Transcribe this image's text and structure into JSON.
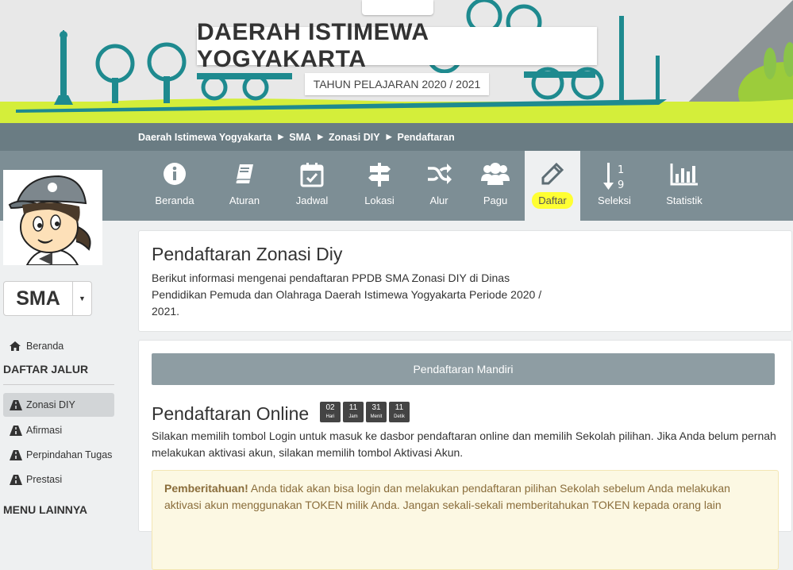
{
  "banner": {
    "title": "DAERAH ISTIMEWA YOGYAKARTA",
    "subtitle": "TAHUN PELAJARAN 2020 / 2021"
  },
  "breadcrumb": [
    "Daerah Istimewa Yogyakarta",
    "SMA",
    "Zonasi DIY",
    "Pendaftaran"
  ],
  "nav": [
    {
      "label": "Beranda",
      "icon": "info-icon"
    },
    {
      "label": "Aturan",
      "icon": "book-icon"
    },
    {
      "label": "Jadwal",
      "icon": "calendar-check-icon"
    },
    {
      "label": "Lokasi",
      "icon": "signpost-icon"
    },
    {
      "label": "Alur",
      "icon": "shuffle-icon"
    },
    {
      "label": "Pagu",
      "icon": "users-icon"
    },
    {
      "label": "Daftar",
      "icon": "pencil-icon",
      "active": true
    },
    {
      "label": "Seleksi",
      "icon": "sort-numeric-icon"
    },
    {
      "label": "Statistik",
      "icon": "bar-chart-icon"
    }
  ],
  "sidebar": {
    "level": "SMA",
    "home": "Beranda",
    "section1": "DAFTAR JALUR",
    "jalur": [
      "Zonasi DIY",
      "Afirmasi",
      "Perpindahan Tugas",
      "Prestasi"
    ],
    "section2": "MENU LAINNYA"
  },
  "main": {
    "title": "Pendaftaran Zonasi Diy",
    "description": "Berikut informasi mengenai pendaftaran PPDB SMA Zonasi DIY di Dinas Pendidikan Pemuda dan Olahraga Daerah Istimewa Yogyakarta Periode 2020 / 2021.",
    "mandiri_button": "Pendaftaran Mandiri",
    "online_title": "Pendaftaran Online",
    "countdown": [
      {
        "value": "02",
        "unit": "Hari"
      },
      {
        "value": "11",
        "unit": "Jam"
      },
      {
        "value": "31",
        "unit": "Menit"
      },
      {
        "value": "11",
        "unit": "Detik"
      }
    ],
    "online_description": "Silakan memilih tombol Login untuk masuk ke dasbor pendaftaran online dan memilih Sekolah pilihan. Jika Anda belum pernah melakukan aktivasi akun, silakan memilih tombol Aktivasi Akun.",
    "notice_label": "Pemberitahuan!",
    "notice_text": " Anda tidak akan bisa login dan melakukan pendaftaran pilihan Sekolah sebelum Anda melakukan aktivasi akun menggunakan TOKEN milik Anda. Jangan sekali-sekali memberitahukan TOKEN kepada orang lain"
  },
  "colors": {
    "navbar": "#7d8e95",
    "crumbbar": "#6a7c83",
    "highlight": "#ffff33",
    "grass": "#d4ee3a",
    "banner_art": "#1e8a8f"
  }
}
